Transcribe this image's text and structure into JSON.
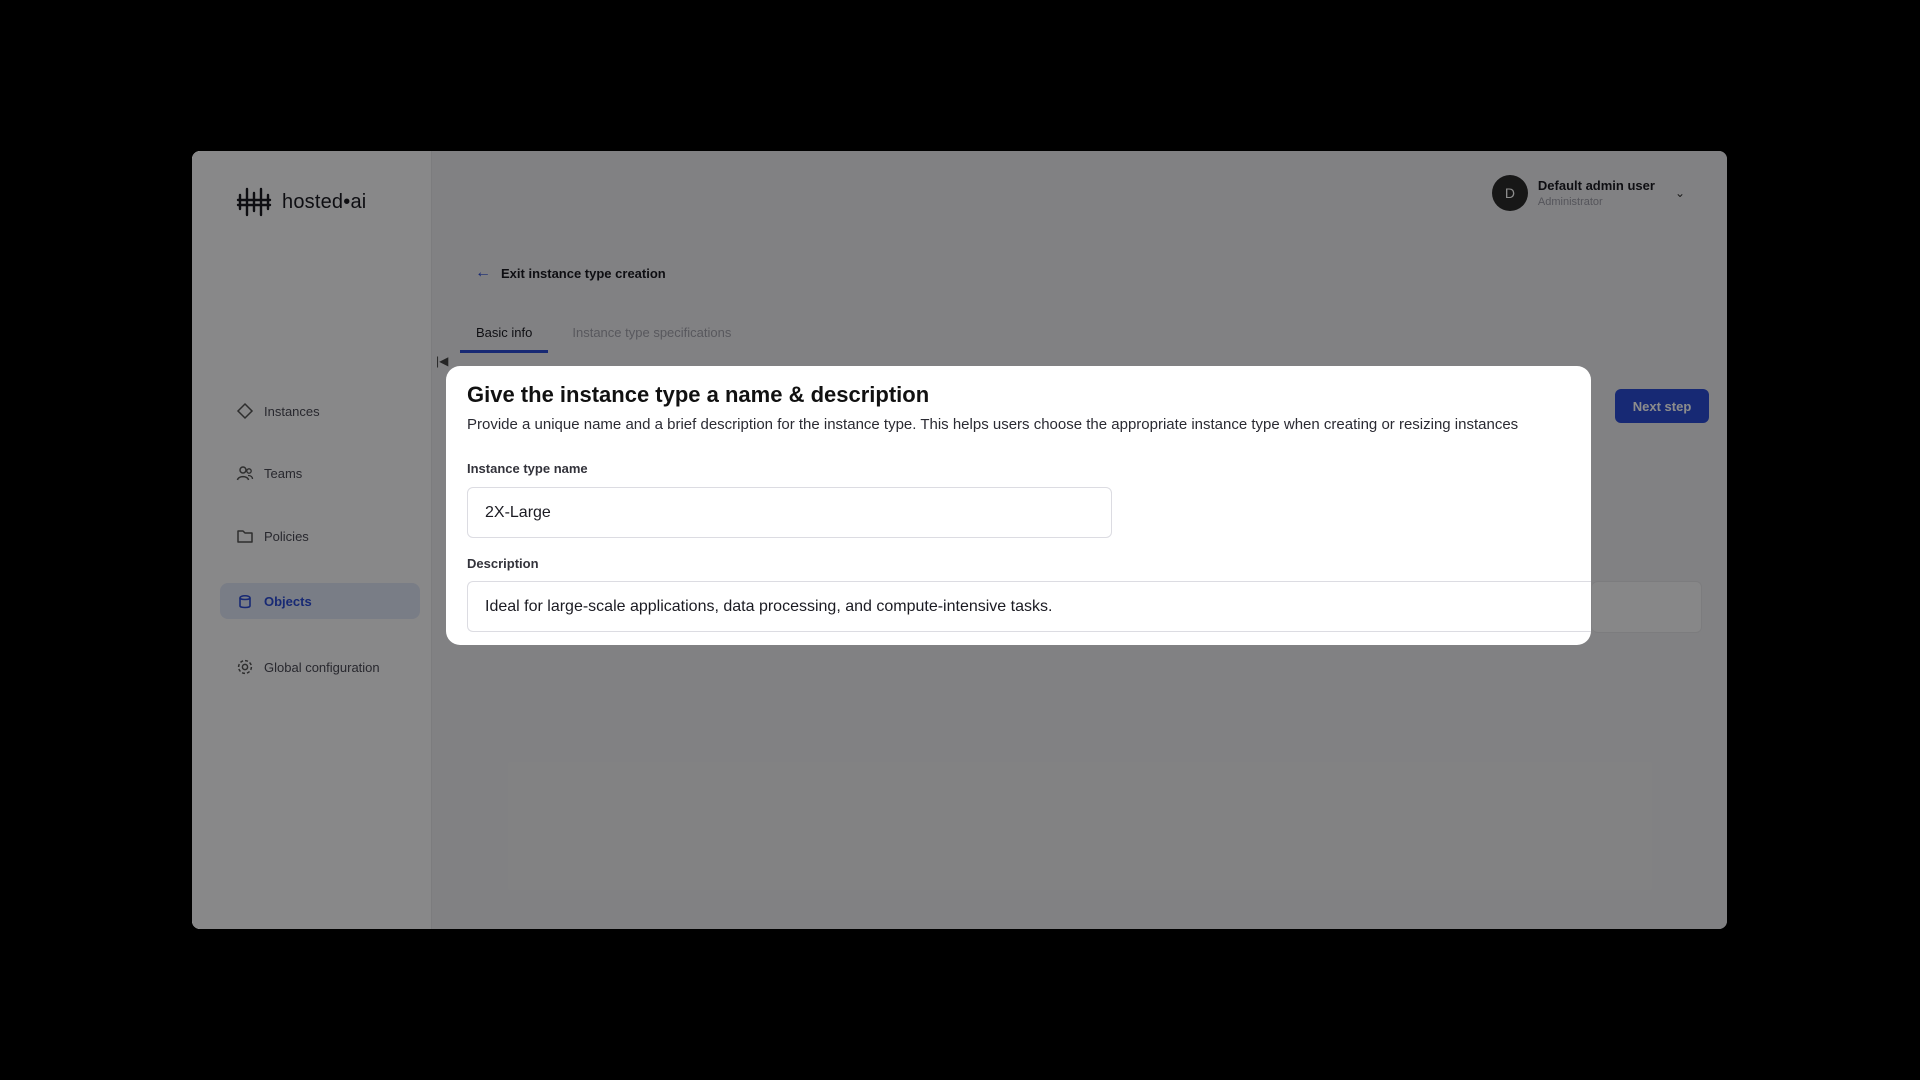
{
  "brand": {
    "name": "hosted•ai"
  },
  "sidebar": {
    "items": [
      {
        "label": "Instances",
        "icon": "diamond-icon"
      },
      {
        "label": "Teams",
        "icon": "users-icon"
      },
      {
        "label": "Policies",
        "icon": "folder-icon"
      },
      {
        "label": "Objects",
        "icon": "cube-icon",
        "active": true
      },
      {
        "label": "Global configuration",
        "icon": "gear-icon"
      }
    ]
  },
  "user": {
    "initial": "D",
    "name": "Default admin user",
    "role": "Administrator"
  },
  "header": {
    "exit_label": "Exit instance type creation"
  },
  "tabs": [
    {
      "label": "Basic info",
      "active": true
    },
    {
      "label": "Instance type specifications",
      "active": false
    }
  ],
  "actions": {
    "next_label": "Next step"
  },
  "modal": {
    "title": "Give the instance type a name & description",
    "subtitle": "Provide a unique name and a brief description for the instance type. This helps users choose the appropriate instance type when creating or resizing instances",
    "name_label": "Instance type name",
    "name_value": "2X-Large",
    "description_label": "Description",
    "description_value": "Ideal for large-scale applications, data processing, and compute-intensive tasks."
  },
  "colors": {
    "accent": "#2b4bd3",
    "backdrop": "#000000"
  }
}
